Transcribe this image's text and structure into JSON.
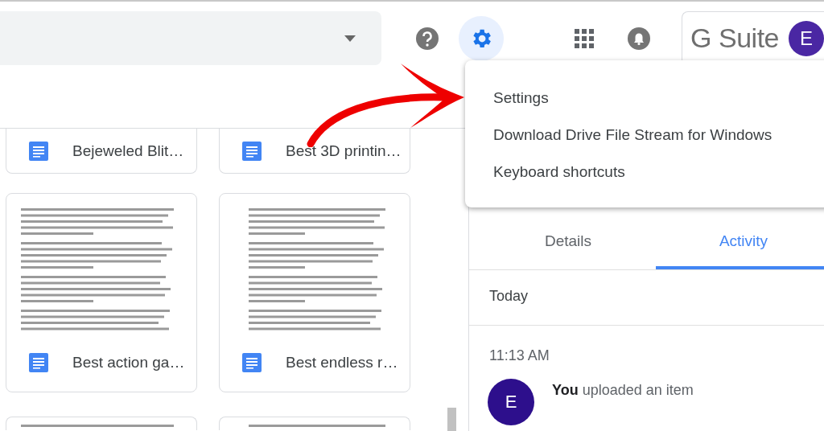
{
  "toolbar": {
    "brand": "G Suite",
    "avatar": "E"
  },
  "settings_menu": {
    "items": [
      "Settings",
      "Download Drive File Stream for Windows",
      "Keyboard shortcuts"
    ]
  },
  "files": [
    {
      "kind": "footer",
      "title": "Bejeweled Blit…"
    },
    {
      "kind": "footer",
      "title": "Best 3D printin…"
    },
    {
      "kind": "full",
      "title": "Best action ga…"
    },
    {
      "kind": "full",
      "title": "Best endless r…"
    },
    {
      "kind": "preview"
    },
    {
      "kind": "preview"
    }
  ],
  "side_panel": {
    "tabs": [
      {
        "label": "Details",
        "selected": false
      },
      {
        "label": "Activity",
        "selected": true
      }
    ],
    "day": "Today",
    "time": "11:13 AM",
    "entries": [
      {
        "avatar": "E",
        "text": "**You** uploaded an item"
      }
    ]
  }
}
